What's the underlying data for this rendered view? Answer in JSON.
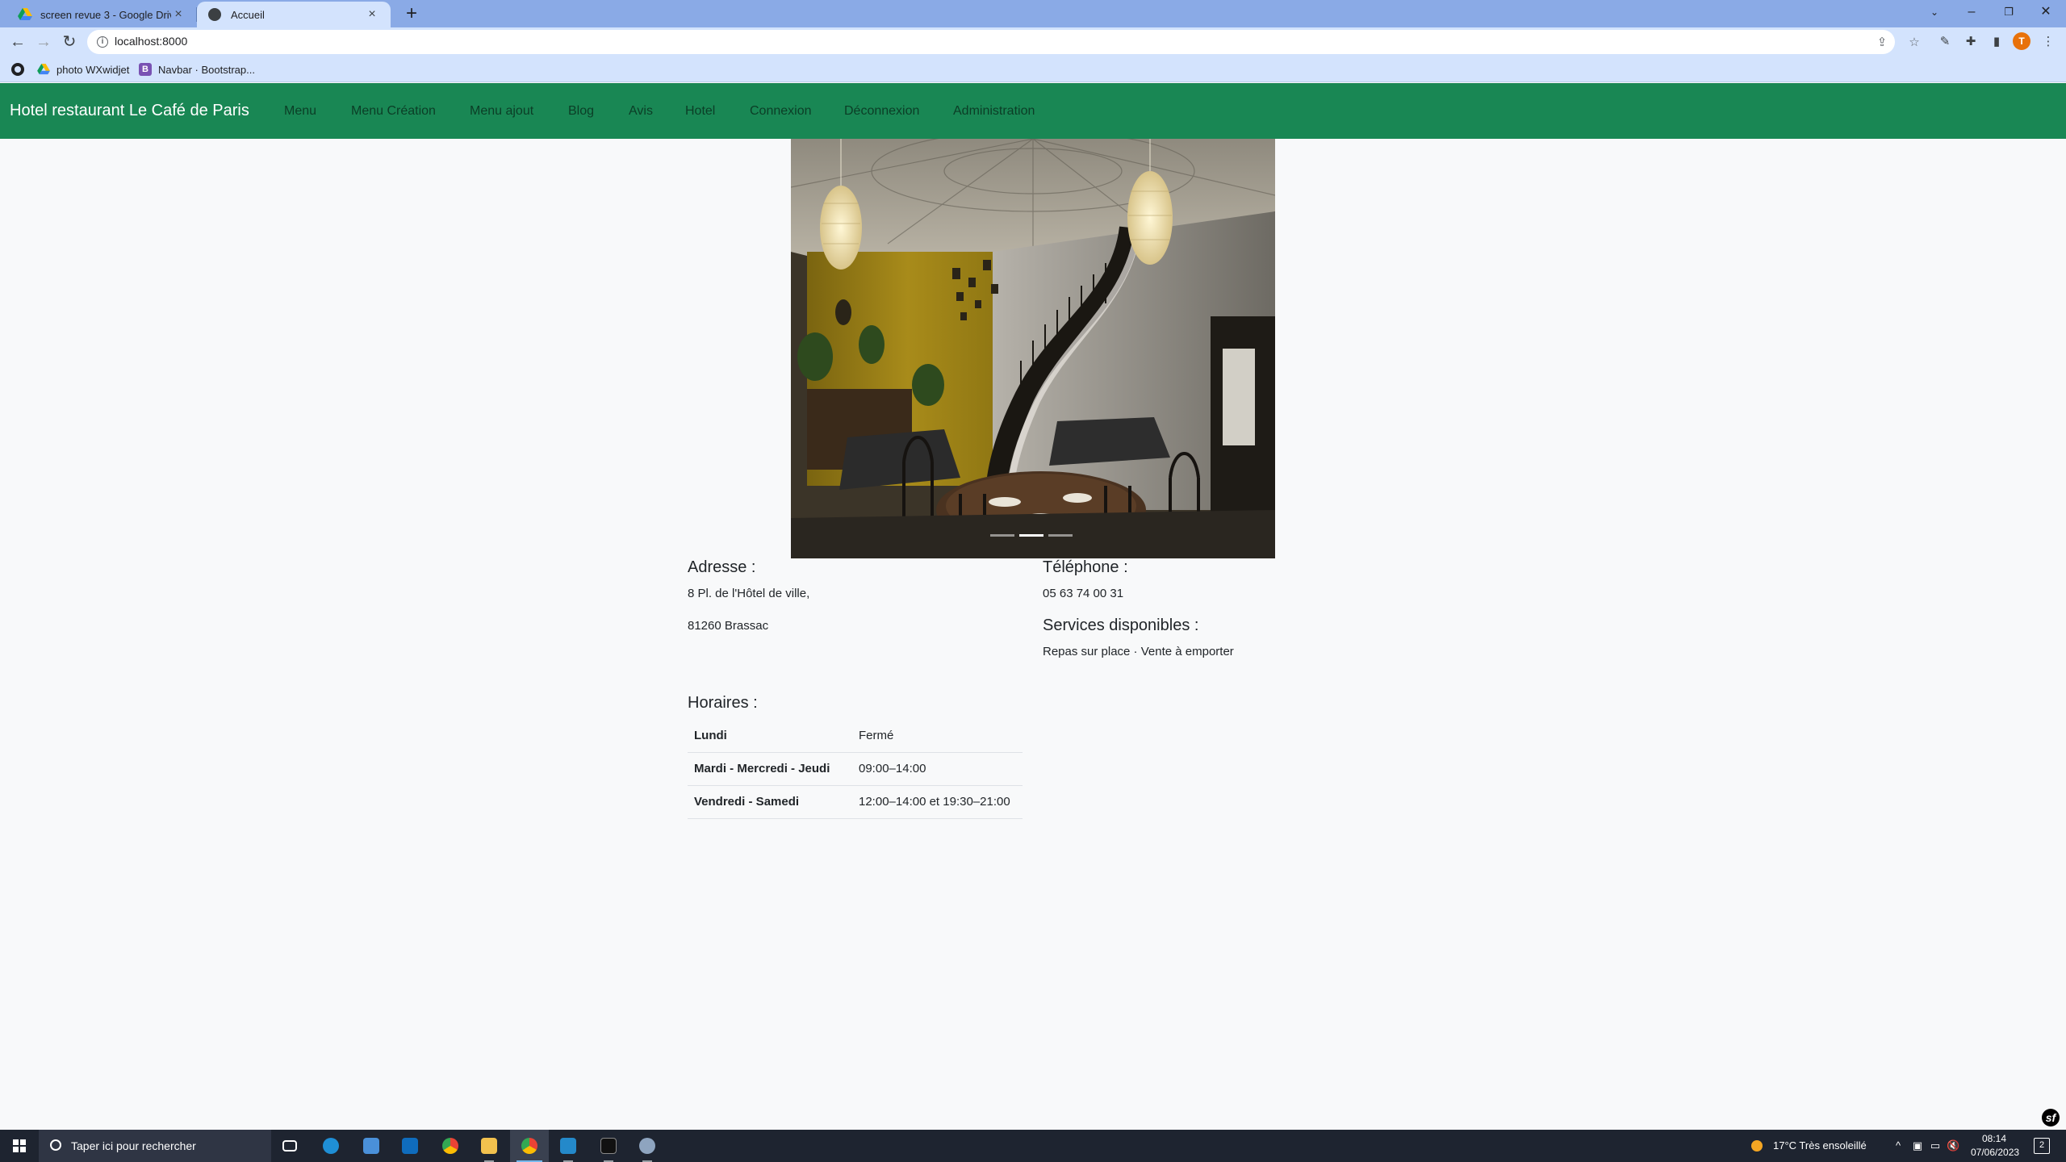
{
  "browser": {
    "tabs": [
      {
        "title": "screen revue 3 - Google Drive",
        "active": false
      },
      {
        "title": "Accueil",
        "active": true
      }
    ],
    "url": "localhost:8000",
    "bookmarks": [
      {
        "label": "photo WXwidjet",
        "icon": "google-drive-icon"
      },
      {
        "label": "Navbar · Bootstrap...",
        "icon": "bootstrap-icon"
      }
    ],
    "profile_initial": "T"
  },
  "navbar": {
    "brand": "Hotel restaurant Le Café de Paris",
    "links": [
      "Menu",
      "Menu Création",
      "Menu ajout",
      "Blog",
      "Avis",
      "Hotel",
      "Connexion",
      "Déconnexion",
      "Administration"
    ],
    "colors": {
      "background": "#198754"
    }
  },
  "carousel": {
    "image_subject": "restaurant dining room with spiral staircase and chandeliers",
    "indicator_count": 3,
    "active_index": 1
  },
  "address": {
    "title": "Adresse :",
    "line1": "8 Pl. de l'Hôtel de ville,",
    "line2": "81260 Brassac"
  },
  "phone": {
    "title": "Téléphone :",
    "number": "05 63 74 00 31"
  },
  "services": {
    "title": "Services disponibles :",
    "text": "Repas sur place · Vente à emporter"
  },
  "hours": {
    "title": "Horaires :",
    "rows": [
      {
        "day": "Lundi",
        "time": "Fermé"
      },
      {
        "day": "Mardi - Mercredi - Jeudi",
        "time": "09:00–14:00"
      },
      {
        "day": "Vendredi - Samedi",
        "time": "12:00–14:00 et 19:30–21:00"
      }
    ]
  },
  "taskbar": {
    "search_placeholder": "Taper ici pour rechercher",
    "weather": "17°C  Très ensoleillé",
    "time": "08:14",
    "date": "07/06/2023",
    "notification_count": "2"
  }
}
